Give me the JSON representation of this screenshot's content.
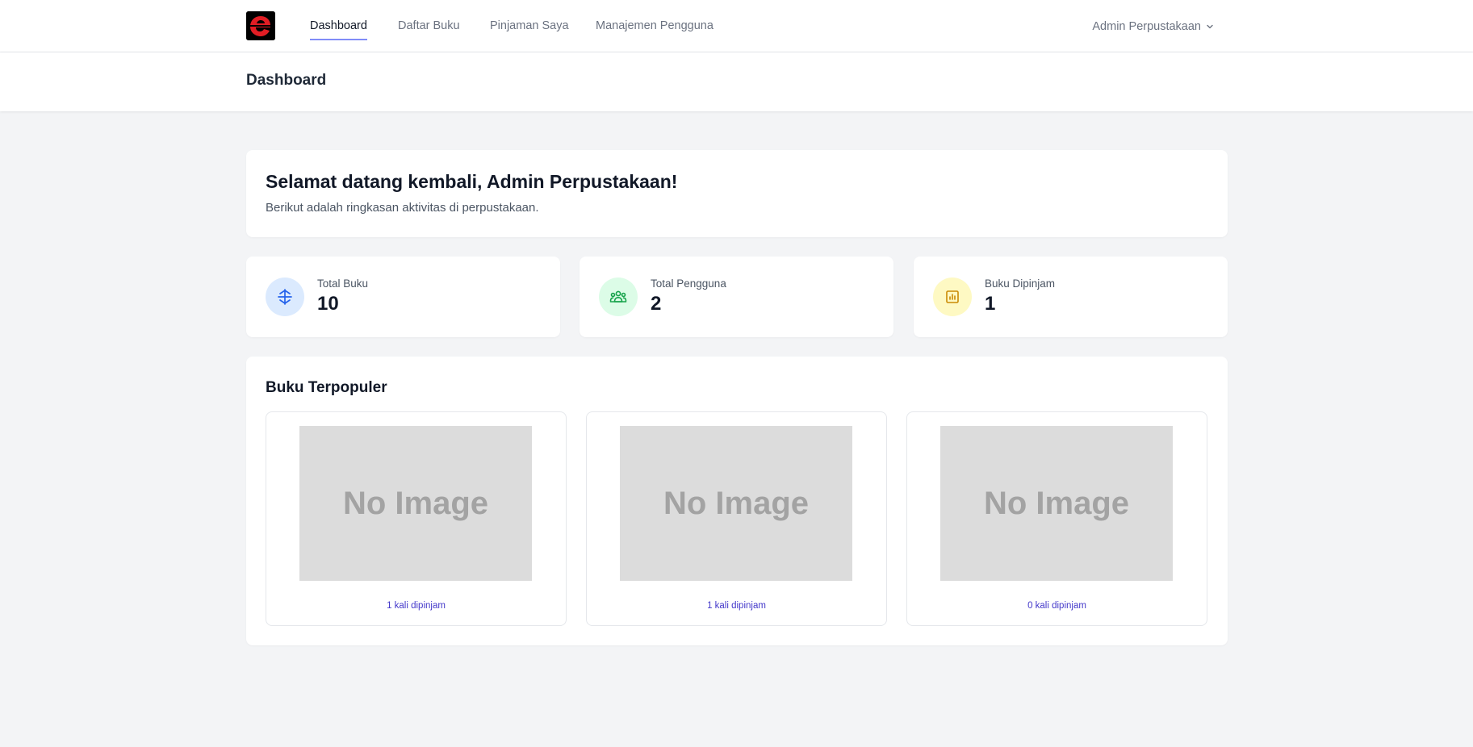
{
  "nav": {
    "items": [
      {
        "label": "Dashboard",
        "active": true
      },
      {
        "label": "Daftar Buku",
        "active": false
      },
      {
        "label": "Pinjaman Saya",
        "active": false
      },
      {
        "label": "Manajemen Pengguna",
        "active": false
      }
    ],
    "user_name": "Admin Perpustakaan",
    "active_underline_color": "#818cf8"
  },
  "header": {
    "title": "Dashboard"
  },
  "welcome": {
    "title": "Selamat datang kembali, Admin Perpustakaan!",
    "subtitle": "Berikut adalah ringkasan aktivitas di perpustakaan."
  },
  "stats": [
    {
      "label": "Total Buku",
      "value": "10",
      "icon": "book-icon",
      "icon_bg": "#dbeafe",
      "icon_color": "#2563eb"
    },
    {
      "label": "Total Pengguna",
      "value": "2",
      "icon": "users-icon",
      "icon_bg": "#dcfce7",
      "icon_color": "#16a34a"
    },
    {
      "label": "Buku Dipinjam",
      "value": "1",
      "icon": "chart-icon",
      "icon_bg": "#fef9c3",
      "icon_color": "#ca8a04"
    }
  ],
  "popular": {
    "title": "Buku Terpopuler",
    "books": [
      {
        "cover_text": "No Image",
        "borrow_text": "1 kali dipinjam"
      },
      {
        "cover_text": "No Image",
        "borrow_text": "1 kali dipinjam"
      },
      {
        "cover_text": "No Image",
        "borrow_text": "0 kali dipinjam"
      }
    ]
  }
}
